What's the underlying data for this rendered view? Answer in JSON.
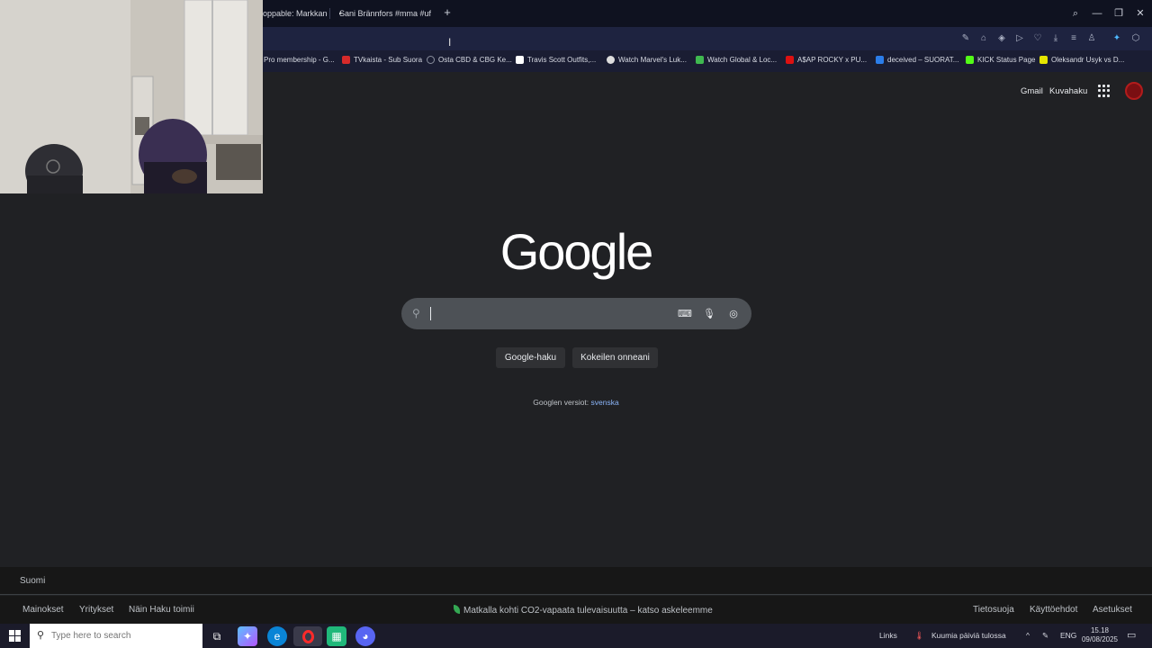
{
  "browser": {
    "tabs": [
      {
        "label": "oppable: Markkanen"
      },
      {
        "label": "Sani Brännfors #mma #ufc"
      }
    ],
    "new_tab_icon": "plus-icon",
    "bookmarks": [
      {
        "label": "Pro membership - G...",
        "color": "#6b6f80"
      },
      {
        "label": "TVkaista - Sub Suora",
        "color": "#d62a2a"
      },
      {
        "label": "Osta CBD & CBG Ke...",
        "color": "#8a8f9e"
      },
      {
        "label": "Travis Scott Outfits,...",
        "color": "#ffffff"
      },
      {
        "label": "Watch Marvel's Luk...",
        "color": "#dddddd"
      },
      {
        "label": "Watch Global & Loc...",
        "color": "#3fb950"
      },
      {
        "label": "A$AP ROCKY x PU...",
        "color": "#d11"
      },
      {
        "label": "deceived – SUORAT...",
        "color": "#2b7de9"
      },
      {
        "label": "KICK Status Page",
        "color": "#53fc18"
      },
      {
        "label": "Oleksandr Usyk vs D...",
        "color": "#e6e600"
      }
    ]
  },
  "google": {
    "gmail": "Gmail",
    "images": "Kuvahaku",
    "logo": "Google",
    "search_placeholder": "",
    "btn_search": "Google-haku",
    "btn_lucky": "Kokeilen onneani",
    "versions_prefix": "Googlen versiot:",
    "versions_lang": "svenska",
    "footer_country": "Suomi",
    "footer_left": [
      "Mainokset",
      "Yritykset",
      "Näin Haku toimii"
    ],
    "footer_center": "Matkalla kohti CO2-vapaata tulevaisuutta – katso askeleemme",
    "footer_right": [
      "Tietosuoja",
      "Käyttöehdot",
      "Asetukset"
    ]
  },
  "taskbar": {
    "search_placeholder": "Type here to search",
    "links": "Links",
    "weather": "Kuumia päiviä tulossa",
    "lang": "ENG",
    "time": "15.18",
    "date": "09/08/2025"
  }
}
